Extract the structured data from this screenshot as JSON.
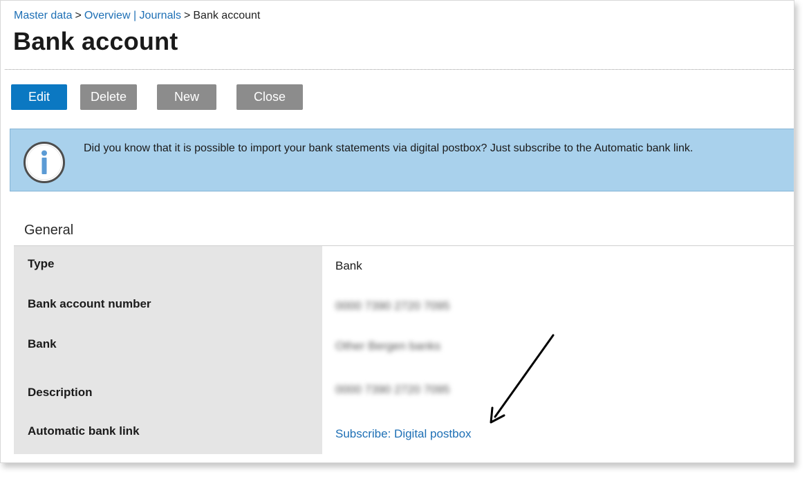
{
  "breadcrumb": {
    "items": [
      "Master data",
      "Overview | Journals"
    ],
    "current": "Bank account",
    "separator": ">"
  },
  "page": {
    "title": "Bank account"
  },
  "toolbar": {
    "edit_label": "Edit",
    "delete_label": "Delete",
    "new_label": "New",
    "close_label": "Close"
  },
  "info": {
    "icon": "info-icon",
    "message": "Did you know that it is possible to import your bank statements via digital postbox? Just subscribe to the Automatic bank link."
  },
  "general": {
    "title": "General",
    "fields": [
      {
        "label": "Type",
        "value": "Bank"
      },
      {
        "label": "Bank account number",
        "value": "0000 7390 2720 7095"
      },
      {
        "label": "Bank",
        "value": "Other Bergen banks"
      },
      {
        "label": "Description",
        "value": "0000 7390 2720 7095"
      },
      {
        "label": "Automatic bank link",
        "value": "Subscribe: Digital postbox"
      }
    ]
  },
  "colors": {
    "primary_button": "#0b78c2",
    "secondary_button": "#8c8c8c",
    "info_background": "#a9d1ec",
    "link": "#1d6fb5",
    "label_column": "#e5e5e5"
  }
}
